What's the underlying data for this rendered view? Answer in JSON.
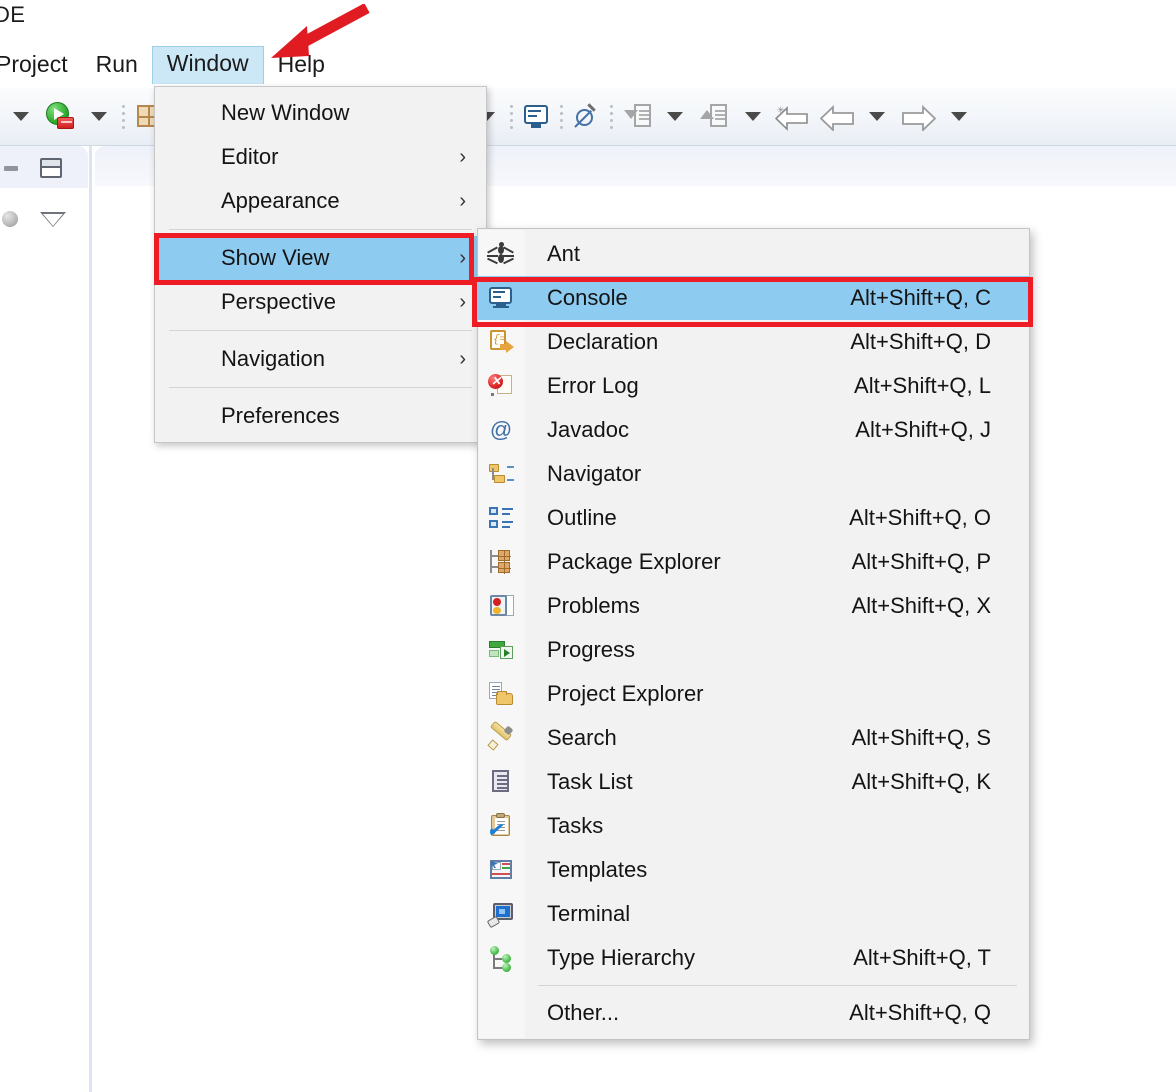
{
  "window": {
    "title": "DE",
    "menubar": [
      {
        "label": "Project",
        "active": false
      },
      {
        "label": "Run",
        "active": false
      },
      {
        "label": "Window",
        "active": true
      },
      {
        "label": "Help",
        "active": false
      }
    ]
  },
  "toolbar": {
    "items": [
      {
        "name": "dropdown-caret-left",
        "icon": "caret-down-icon"
      },
      {
        "name": "run-button",
        "icon": "run-green-play-icon"
      },
      {
        "name": "run-dropdown-caret",
        "icon": "caret-down-icon"
      },
      {
        "name": "open-perspective-button",
        "icon": "perspective-grid-icon"
      },
      {
        "name": "perspective-dropdown-caret",
        "icon": "caret-down-icon"
      },
      {
        "name": "console-button",
        "icon": "console-monitor-icon"
      },
      {
        "name": "skip-breakpoints-button",
        "icon": "no-symbol-pen-icon"
      },
      {
        "name": "step-into-button",
        "icon": "step-into-icon"
      },
      {
        "name": "step-into-dropdown-caret",
        "icon": "caret-down-icon"
      },
      {
        "name": "step-return-button",
        "icon": "step-return-icon"
      },
      {
        "name": "step-return-dropdown-caret",
        "icon": "caret-down-icon"
      },
      {
        "name": "back-to-button",
        "icon": "back-star-arrow-icon"
      },
      {
        "name": "back-button",
        "icon": "arrow-left-icon"
      },
      {
        "name": "back-dropdown-caret",
        "icon": "caret-down-icon"
      },
      {
        "name": "forward-button",
        "icon": "arrow-right-icon"
      },
      {
        "name": "forward-dropdown-caret",
        "icon": "caret-down-icon"
      }
    ]
  },
  "window_menu": {
    "items": [
      {
        "label": "New Window",
        "submenu": false,
        "selected": false,
        "separator_after": false
      },
      {
        "label": "Editor",
        "submenu": true,
        "selected": false,
        "separator_after": false
      },
      {
        "label": "Appearance",
        "submenu": true,
        "selected": false,
        "separator_after": true
      },
      {
        "label": "Show View",
        "submenu": true,
        "selected": true,
        "separator_after": false
      },
      {
        "label": "Perspective",
        "submenu": true,
        "selected": false,
        "separator_after": true
      },
      {
        "label": "Navigation",
        "submenu": true,
        "selected": false,
        "separator_after": true
      },
      {
        "label": "Preferences",
        "submenu": false,
        "selected": false,
        "separator_after": false
      }
    ],
    "submenu_arrow": "›"
  },
  "show_view_menu": {
    "items": [
      {
        "label": "Ant",
        "accel": "",
        "icon": "ant-icon",
        "selected": false,
        "separator_after": false
      },
      {
        "label": "Console",
        "accel": "Alt+Shift+Q, C",
        "icon": "console-icon",
        "selected": true,
        "separator_after": false
      },
      {
        "label": "Declaration",
        "accel": "Alt+Shift+Q, D",
        "icon": "declaration-icon",
        "selected": false,
        "separator_after": false
      },
      {
        "label": "Error Log",
        "accel": "Alt+Shift+Q, L",
        "icon": "error-log-icon",
        "selected": false,
        "separator_after": false
      },
      {
        "label": "Javadoc",
        "accel": "Alt+Shift+Q, J",
        "icon": "javadoc-icon",
        "selected": false,
        "separator_after": false
      },
      {
        "label": "Navigator",
        "accel": "",
        "icon": "navigator-icon",
        "selected": false,
        "separator_after": false
      },
      {
        "label": "Outline",
        "accel": "Alt+Shift+Q, O",
        "icon": "outline-icon",
        "selected": false,
        "separator_after": false
      },
      {
        "label": "Package Explorer",
        "accel": "Alt+Shift+Q, P",
        "icon": "package-explorer-icon",
        "selected": false,
        "separator_after": false
      },
      {
        "label": "Problems",
        "accel": "Alt+Shift+Q, X",
        "icon": "problems-icon",
        "selected": false,
        "separator_after": false
      },
      {
        "label": "Progress",
        "accel": "",
        "icon": "progress-icon",
        "selected": false,
        "separator_after": false
      },
      {
        "label": "Project Explorer",
        "accel": "",
        "icon": "project-explorer-icon",
        "selected": false,
        "separator_after": false
      },
      {
        "label": "Search",
        "accel": "Alt+Shift+Q, S",
        "icon": "search-icon",
        "selected": false,
        "separator_after": false
      },
      {
        "label": "Task List",
        "accel": "Alt+Shift+Q, K",
        "icon": "task-list-icon",
        "selected": false,
        "separator_after": false
      },
      {
        "label": "Tasks",
        "accel": "",
        "icon": "tasks-icon",
        "selected": false,
        "separator_after": false
      },
      {
        "label": "Templates",
        "accel": "",
        "icon": "templates-icon",
        "selected": false,
        "separator_after": false
      },
      {
        "label": "Terminal",
        "accel": "",
        "icon": "terminal-icon",
        "selected": false,
        "separator_after": false
      },
      {
        "label": "Type Hierarchy",
        "accel": "Alt+Shift+Q, T",
        "icon": "type-hierarchy-icon",
        "selected": false,
        "separator_after": true
      },
      {
        "label": "Other...",
        "accel": "Alt+Shift+Q, Q",
        "icon": "",
        "selected": false,
        "separator_after": false
      }
    ]
  },
  "left_panel": {
    "restore_icon": "restore-view-icon",
    "minimize_icon": "minimize-view-icon",
    "sphere_icon": "sphere-icon",
    "view_menu_icon": "view-menu-caret-icon"
  },
  "annotations": {
    "colors": {
      "highlight_red": "#ee1c24",
      "selection_blue": "#8ecbf0",
      "menubar_active": "#cce8f7"
    },
    "arrow": "red-arrow-pointing-to-window-menu",
    "boxes": [
      {
        "name": "show-view-highlight-box",
        "target": "Show View"
      },
      {
        "name": "console-highlight-box",
        "target": "Console"
      }
    ]
  }
}
